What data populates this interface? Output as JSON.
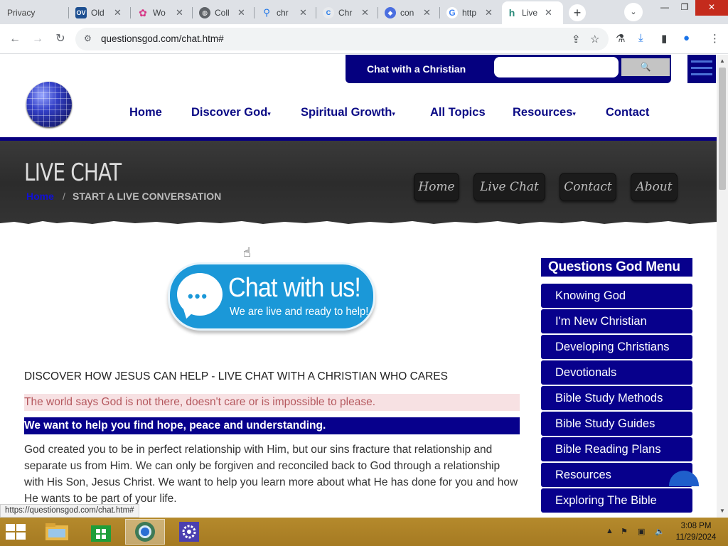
{
  "browser": {
    "tabs": [
      {
        "label": "Privacy",
        "icon": "privacy-favicon",
        "color": "#9e9e9e"
      },
      {
        "label": "Old",
        "icon": "ov-favicon",
        "color": "#1d4f91"
      },
      {
        "label": "Wo",
        "icon": "flower-favicon",
        "color": "#d63384"
      },
      {
        "label": "Coll",
        "icon": "globe-favicon",
        "color": "#5f6368"
      },
      {
        "label": "chr",
        "icon": "search-favicon",
        "color": "#1a73e8"
      },
      {
        "label": "Chr",
        "icon": "chrome-favicon",
        "color": "#1a73e8"
      },
      {
        "label": "con",
        "icon": "chatgpt-favicon",
        "color": "#4a6ee0"
      },
      {
        "label": "http",
        "icon": "google-favicon",
        "color": "#4285f4"
      },
      {
        "label": "Live",
        "icon": "site-favicon",
        "color": "#2a8a7a"
      }
    ],
    "url": "questionsgod.com/chat.htm#",
    "status_url": "https://questionsgod.com/chat.htm#"
  },
  "site": {
    "chat_bar_label": "Chat with a Christian",
    "search_placeholder": "",
    "search_button": "🔍",
    "nav": [
      "Home",
      "Discover God",
      "Spiritual Growth",
      "All Topics",
      "Resources",
      "Contact"
    ],
    "hero_title": "LIVE CHAT",
    "breadcrumb_home": "Home",
    "breadcrumb_sep": "/",
    "breadcrumb_current": "START A LIVE CONVERSATION",
    "hero_buttons": [
      "Home",
      "Live Chat",
      "Contact",
      "About"
    ],
    "chat_badge_title": "Chat with us!",
    "chat_badge_sub": "We are live and ready to help!",
    "heading": "DISCOVER HOW JESUS CAN HELP - LIVE CHAT WITH A CHRISTIAN WHO CARES",
    "highlight_pink": "The world says God is not there, doesn't care or is impossible to please.",
    "highlight_blue": "We want to help you find hope, peace and understanding.",
    "paragraph": "God created you to be in perfect relationship with Him, but our sins fracture that relationship and separate us from Him. We can only be forgiven and reconciled back to God through a relationship with His Son, Jesus Christ. We want to help you learn more about what He has done for you and how He wants to be part of your life.",
    "side_menu_title": "Questions God Menu",
    "side_menu": [
      "Knowing God",
      "I'm New Christian",
      "Developing Christians",
      "Devotionals",
      "Bible Study Methods",
      "Bible Study Guides",
      "Bible Reading Plans",
      "Resources",
      "Exploring The Bible"
    ]
  },
  "taskbar": {
    "time": "3:08 PM",
    "date": "11/29/2024"
  }
}
